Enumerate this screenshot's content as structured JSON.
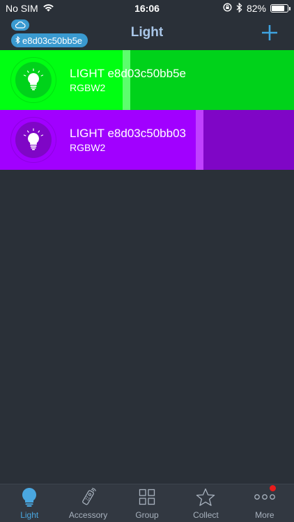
{
  "status_bar": {
    "carrier": "No SIM",
    "time": "16:06",
    "battery": "82%",
    "battery_level": 0.82,
    "icons": [
      "wifi-icon",
      "orientation-lock-icon",
      "bluetooth-icon",
      "battery-icon"
    ]
  },
  "nav": {
    "title": "Light",
    "bt_device": "e8d03c50bb5e",
    "cloud_icon": "cloud-icon",
    "bt_icon": "bluetooth-icon",
    "add_icon": "plus-icon"
  },
  "devices": [
    {
      "name": "LIGHT e8d03c50bb5e",
      "type": "RGBW2",
      "color": "#00ff12",
      "dark_color": "#00d21a",
      "divider_color": "#5cff6c",
      "icon": "lightbulb-icon"
    },
    {
      "name": "LIGHT e8d03c50bb03",
      "type": "RGBW2",
      "color": "#a100ff",
      "dark_color": "#7f06c6",
      "divider_color": "#c040ff",
      "icon": "lightbulb-icon"
    }
  ],
  "tabs": [
    {
      "label": "Light",
      "icon": "lightbulb-icon",
      "active": true
    },
    {
      "label": "Accessory",
      "icon": "remote-icon",
      "active": false
    },
    {
      "label": "Group",
      "icon": "grid-icon",
      "active": false
    },
    {
      "label": "Collect",
      "icon": "star-icon",
      "active": false
    },
    {
      "label": "More",
      "icon": "more-icon",
      "active": false,
      "badge": true
    }
  ],
  "colors": {
    "background": "#2a3038",
    "accent": "#4aa7e0",
    "title": "#a9c6e8",
    "badge": "#3a9ad0"
  }
}
